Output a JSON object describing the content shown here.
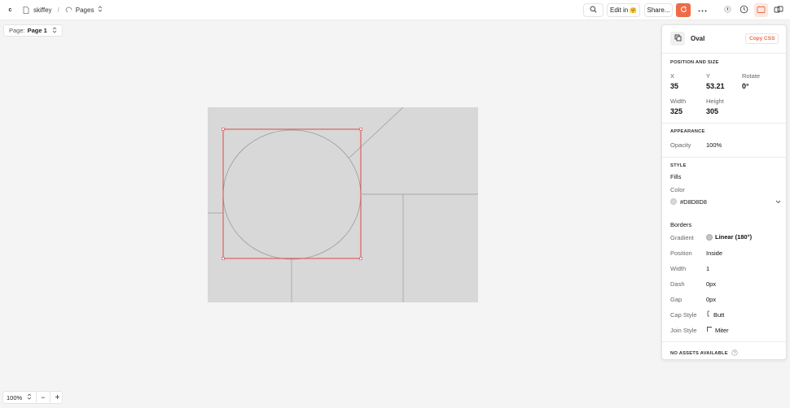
{
  "topbar": {
    "logo": "c",
    "crumbs": [
      "skiffey",
      "Pages"
    ],
    "separator": "/",
    "search_icon": "search-icon",
    "edit_in_label": "Edit in",
    "edit_in_emoji": "🤗",
    "share_label": "Share...",
    "refresh_color": "#ef6b47"
  },
  "page_select": {
    "label": "Page:",
    "value": "Page 1"
  },
  "zoom": {
    "value": "100%",
    "minus": "−",
    "plus": "+"
  },
  "panel": {
    "element_name": "Oval",
    "copy_css_label": "Copy CSS",
    "position_size_title": "POSITION AND SIZE",
    "x_label": "X",
    "x_value": "35",
    "y_label": "Y",
    "y_value": "53.21",
    "rotate_label": "Rotate",
    "rotate_value": "0°",
    "width_label": "Width",
    "width_value": "325",
    "height_label": "Height",
    "height_value": "305",
    "appearance_title": "APPEARANCE",
    "opacity_label": "Opacity",
    "opacity_value": "100%",
    "style_title": "STYLE",
    "fills_label": "Fills",
    "color_label": "Color",
    "color_value": "#D8D8D8",
    "borders_label": "Borders",
    "gradient_label": "Gradient",
    "gradient_value": "Linear (180°)",
    "position_label": "Position",
    "position_value": "Inside",
    "border_width_label": "Width",
    "border_width_value": "1",
    "dash_label": "Dash",
    "dash_value": "0px",
    "gap_label": "Gap",
    "gap_value": "0px",
    "cap_style_label": "Cap Style",
    "cap_style_value": "Butt",
    "join_style_label": "Join Style",
    "join_style_value": "Miter",
    "no_assets_label": "NO ASSETS AVAILABLE"
  },
  "colors": {
    "accent": "#ef6b47",
    "selection": "#e04848",
    "canvas_fill": "#d8d8d8"
  }
}
